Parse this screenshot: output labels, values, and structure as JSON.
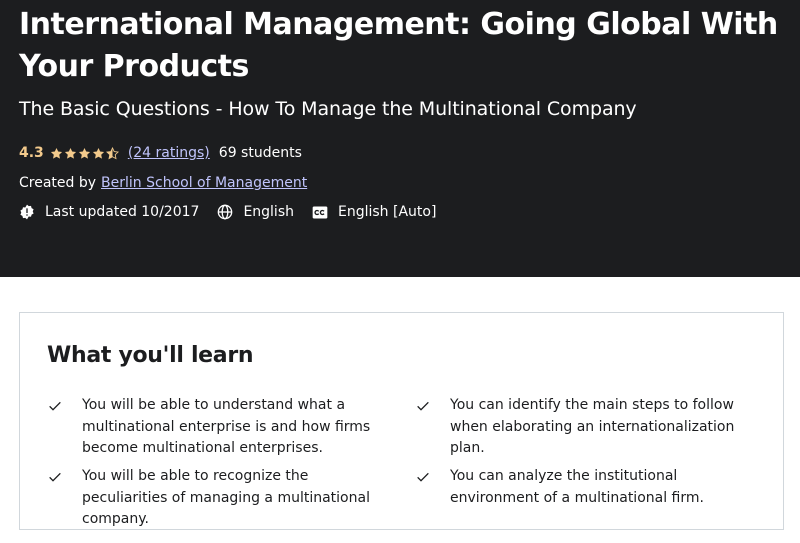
{
  "header": {
    "title": "International Management: Going Global With Your Products",
    "subtitle": "The Basic Questions - How To Manage the Multinational Company",
    "rating": {
      "value": "4.3",
      "stars_filled": 4.3,
      "stars_total": 5,
      "ratings_link": "(24 ratings)",
      "students": "69 students"
    },
    "created_by_label": "Created by",
    "author": "Berlin School of Management",
    "meta": {
      "last_updated": "Last updated 10/2017",
      "language": "English",
      "captions": "English [Auto]"
    },
    "colors": {
      "background": "#1c1d1f",
      "rating": "#f3ca8c",
      "link": "#c0c4fc"
    },
    "icons": {
      "last_updated": "alert-badge-icon",
      "language": "globe-icon",
      "captions": "closed-captions-icon"
    }
  },
  "learn": {
    "heading": "What you'll learn",
    "check_icon": "check-icon",
    "items": [
      {
        "text": "You will be able to understand what a multinational enterprise is and how firms become multinational enterprises."
      },
      {
        "text": "You can identify the main steps to follow when elaborating an internationalization plan."
      },
      {
        "text": "You will be able to recognize the peculiarities of managing a multinational company."
      },
      {
        "text": "You can analyze the institutional environment of a multinational firm."
      }
    ]
  }
}
